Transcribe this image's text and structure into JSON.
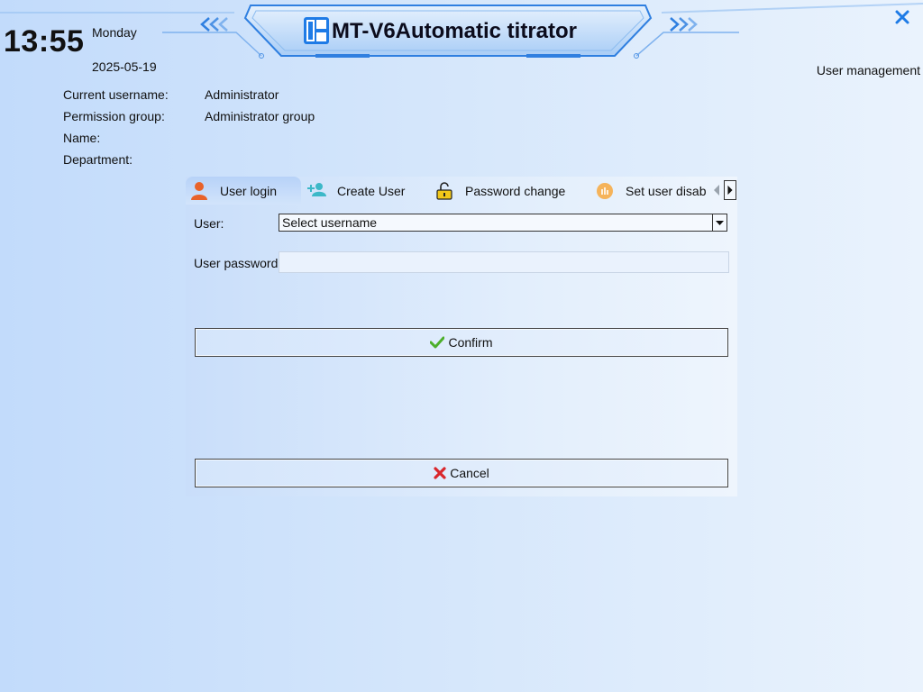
{
  "header": {
    "time": "13:55",
    "weekday": "Monday",
    "date": "2025-05-19",
    "title": "MT-V6Automatic titrator",
    "section": "User management",
    "close_icon": "close-icon"
  },
  "user_info": {
    "rows": [
      {
        "label": "Current username:",
        "value": "Administrator"
      },
      {
        "label": "Permission group:",
        "value": "Administrator group"
      },
      {
        "label": "Name:",
        "value": ""
      },
      {
        "label": "Department:",
        "value": ""
      }
    ]
  },
  "tabs": [
    {
      "label": "User login",
      "icon": "user-icon",
      "active": true
    },
    {
      "label": "Create User",
      "icon": "add-user-icon",
      "active": false
    },
    {
      "label": "Password change",
      "icon": "unlock-icon",
      "active": false
    },
    {
      "label": "Set user disab",
      "icon": "chart-badge-icon",
      "active": false
    }
  ],
  "form": {
    "user_label": "User:",
    "user_select_value": "Select username",
    "password_label": "User password:",
    "password_value": "",
    "confirm_label": "Confirm",
    "cancel_label": "Cancel"
  },
  "colors": {
    "accent": "#1e7be6",
    "confirm_check": "#4caf2a",
    "cancel_x": "#d9262b",
    "user_icon": "#e8622a",
    "add_user_icon": "#3cb8c8",
    "lock_icon": "#f2c81a",
    "badge_icon": "#f5b35a"
  }
}
